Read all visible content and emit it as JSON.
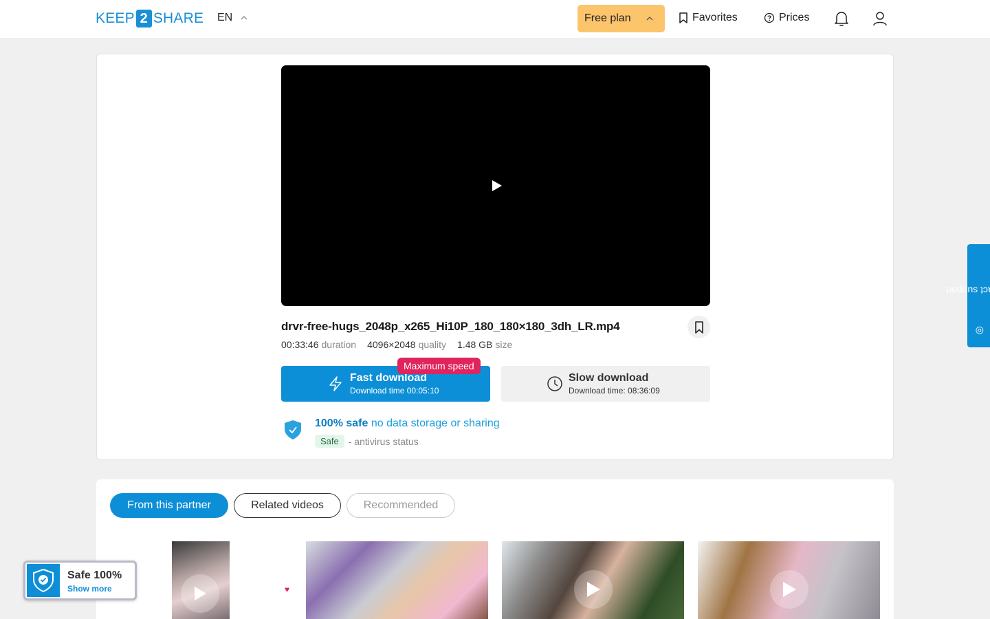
{
  "header": {
    "logo_left": "KEEP",
    "logo_num": "2",
    "logo_right": "SHARE",
    "lang": "EN",
    "plan": "Free plan",
    "favorites": "Favorites",
    "prices": "Prices"
  },
  "video": {
    "filename": "drvr-free-hugs_2048p_x265_Hi10P_180_180×180_3dh_LR.mp4",
    "duration_value": "00:33:46",
    "duration_label": "duration",
    "quality_value": "4096×2048",
    "quality_label": "quality",
    "size_value": "1.48 GB",
    "size_label": "size"
  },
  "download": {
    "fast_title": "Fast download",
    "fast_time": "Download time 00:05:10",
    "max_badge": "Maximum speed",
    "slow_title": "Slow download",
    "slow_time": "Download time: 08:36:09"
  },
  "safety": {
    "strong": "100% safe",
    "rest": "no data storage or sharing",
    "pill": "Safe",
    "status": "- antivirus status"
  },
  "support": "contact support",
  "tabs": [
    "From this partner",
    "Related videos",
    "Recommended"
  ],
  "widget": {
    "title": "Safe 100%",
    "link": "Show more"
  },
  "colors": {
    "accent": "#0d8fd8",
    "plan": "#fcc46b",
    "badge": "#e0245e"
  }
}
